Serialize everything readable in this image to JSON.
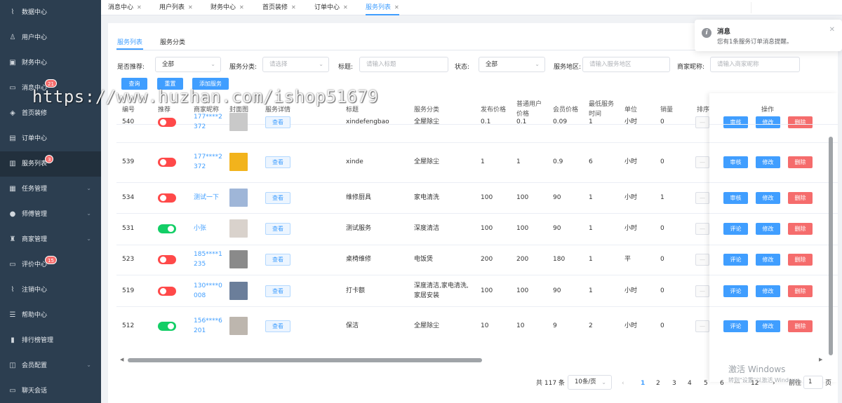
{
  "sidebar": {
    "items": [
      {
        "label": "数据中心",
        "icon": "chart-line-icon",
        "badge": "",
        "chevron": false,
        "active": false
      },
      {
        "label": "用户中心",
        "icon": "user-icon",
        "badge": "",
        "chevron": false,
        "active": false
      },
      {
        "label": "财务中心",
        "icon": "wallet-icon",
        "badge": "",
        "chevron": false,
        "active": false
      },
      {
        "label": "消息中心",
        "icon": "message-icon",
        "badge": "21",
        "chevron": false,
        "active": false
      },
      {
        "label": "首页装修",
        "icon": "cube-icon",
        "badge": "",
        "chevron": false,
        "active": false
      },
      {
        "label": "订单中心",
        "icon": "order-icon",
        "badge": "",
        "chevron": false,
        "active": false
      },
      {
        "label": "服务列表",
        "icon": "clipboard-icon",
        "badge": "3",
        "chevron": false,
        "active": true
      },
      {
        "label": "任务管理",
        "icon": "grid-icon",
        "badge": "",
        "chevron": true,
        "active": false
      },
      {
        "label": "师傅管理",
        "icon": "worker-icon",
        "badge": "",
        "chevron": true,
        "active": false
      },
      {
        "label": "商家管理",
        "icon": "merchant-icon",
        "badge": "",
        "chevron": true,
        "active": false
      },
      {
        "label": "评价中心",
        "icon": "comment-icon",
        "badge": "15",
        "chevron": false,
        "active": false
      },
      {
        "label": "注销中心",
        "icon": "logout-chart-icon",
        "badge": "",
        "chevron": false,
        "active": false
      },
      {
        "label": "帮助中心",
        "icon": "list-icon",
        "badge": "",
        "chevron": false,
        "active": false
      },
      {
        "label": "排行榜管理",
        "icon": "bar-chart-icon",
        "badge": "",
        "chevron": false,
        "active": false
      },
      {
        "label": "会员配置",
        "icon": "settings-box-icon",
        "badge": "",
        "chevron": true,
        "active": false
      },
      {
        "label": "聊天会话",
        "icon": "chat-icon",
        "badge": "",
        "chevron": false,
        "active": false
      }
    ]
  },
  "tabs": [
    {
      "label": "消息中心",
      "active": false
    },
    {
      "label": "用户列表",
      "active": false
    },
    {
      "label": "财务中心",
      "active": false
    },
    {
      "label": "首页装修",
      "active": false
    },
    {
      "label": "订单中心",
      "active": false
    },
    {
      "label": "服务列表",
      "active": true
    }
  ],
  "subtabs": [
    "服务列表",
    "服务分类"
  ],
  "filters": {
    "recommend_label": "是否推荐:",
    "recommend_value": "全部",
    "category_label": "服务分类:",
    "category_placeholder": "请选择",
    "title_label": "标题:",
    "title_placeholder": "请输入标题",
    "status_label": "状态:",
    "status_value": "全部",
    "region_label": "服务地区:",
    "region_placeholder": "请输入服务地区",
    "merchant_label": "商家昵称:",
    "merchant_placeholder": "请输入商家昵称"
  },
  "actions": {
    "query": "查询",
    "reset": "重置",
    "add": "添加服务"
  },
  "table": {
    "headers": {
      "id": "编号",
      "recommend": "推荐",
      "merchant": "商家昵称",
      "cover": "封面图",
      "detail": "服务详情",
      "title": "标题",
      "category": "服务分类",
      "price": "发布价格",
      "normal_price_1": "普通用户",
      "normal_price_2": "价格",
      "member_price": "会员价格",
      "min_time_1": "最低服务",
      "min_time_2": "时间",
      "unit": "单位",
      "sales": "销量",
      "sort": "排序",
      "ops": "操作"
    },
    "view_label": "查看",
    "rows": [
      {
        "id": "540",
        "on": false,
        "merchant_1": "177****2",
        "merchant_2": "372",
        "title": "xindefengbao",
        "category_1": "全屋除尘",
        "category_2": "",
        "price": "0.1",
        "normal": "0.1",
        "member": "0.09",
        "min": "1",
        "unit": "小时",
        "sales": "0",
        "op1": "审核",
        "op2": "修改",
        "op3": "删除",
        "thumb": "#c9c9c9"
      },
      {
        "id": "539",
        "on": false,
        "merchant_1": "177****2",
        "merchant_2": "372",
        "title": "xinde",
        "category_1": "全屋除尘",
        "category_2": "",
        "price": "1",
        "normal": "1",
        "member": "0.9",
        "min": "6",
        "unit": "小时",
        "sales": "0",
        "op1": "审核",
        "op2": "修改",
        "op3": "删除",
        "thumb": "#f2b31c"
      },
      {
        "id": "534",
        "on": false,
        "merchant_1": "测试一下",
        "merchant_2": "",
        "title": "维修厨具",
        "category_1": "家电清洗",
        "category_2": "",
        "price": "100",
        "normal": "100",
        "member": "90",
        "min": "1",
        "unit": "小时",
        "sales": "1",
        "op1": "审核",
        "op2": "修改",
        "op3": "删除",
        "thumb": "#9fb6d8"
      },
      {
        "id": "531",
        "on": true,
        "merchant_1": "小张",
        "merchant_2": "",
        "title": "测试服务",
        "category_1": "深度清洁",
        "category_2": "",
        "price": "100",
        "normal": "100",
        "member": "90",
        "min": "1",
        "unit": "小时",
        "sales": "0",
        "op1": "评论",
        "op2": "修改",
        "op3": "删除",
        "thumb": "#d9d2cc"
      },
      {
        "id": "523",
        "on": false,
        "merchant_1": "185****1",
        "merchant_2": "235",
        "title": "桌椅维修",
        "category_1": "电饭煲",
        "category_2": "",
        "price": "200",
        "normal": "200",
        "member": "180",
        "min": "1",
        "unit": "平",
        "sales": "0",
        "op1": "评论",
        "op2": "修改",
        "op3": "删除",
        "thumb": "#8a8a8a"
      },
      {
        "id": "519",
        "on": false,
        "merchant_1": "130****0",
        "merchant_2": "008",
        "title": "打卡额",
        "category_1": "深度清洁,家电清洗,",
        "category_2": "家居安装",
        "price": "100",
        "normal": "100",
        "member": "90",
        "min": "1",
        "unit": "小时",
        "sales": "0",
        "op1": "评论",
        "op2": "修改",
        "op3": "删除",
        "thumb": "#6b7e9a"
      },
      {
        "id": "512",
        "on": true,
        "merchant_1": "156****6",
        "merchant_2": "201",
        "title": "保洁",
        "category_1": "全屋除尘",
        "category_2": "",
        "price": "10",
        "normal": "10",
        "member": "9",
        "min": "2",
        "unit": "小时",
        "sales": "0",
        "op1": "评论",
        "op2": "修改",
        "op3": "删除",
        "thumb": "#bdb6ae"
      }
    ]
  },
  "pagination": {
    "total": "共 117 条",
    "page_size": "10条/页",
    "pages": [
      "1",
      "2",
      "3",
      "4",
      "5",
      "6",
      "···",
      "12"
    ],
    "goto_label": "前往",
    "goto_value": "1"
  },
  "notification": {
    "title": "消息",
    "message": "您有1条服务订单消息提醒。"
  },
  "watermark": "https://www.huzhan.com/ishop51679",
  "windows": {
    "line1": "激活 Windows",
    "line2": "转到\"设置\"以激活 Windows。"
  },
  "colors": {
    "primary": "#409eff",
    "danger": "#f56c6c",
    "success": "#13ce66",
    "switch_off": "#ff4949",
    "sidebar": "#2c3e50"
  }
}
